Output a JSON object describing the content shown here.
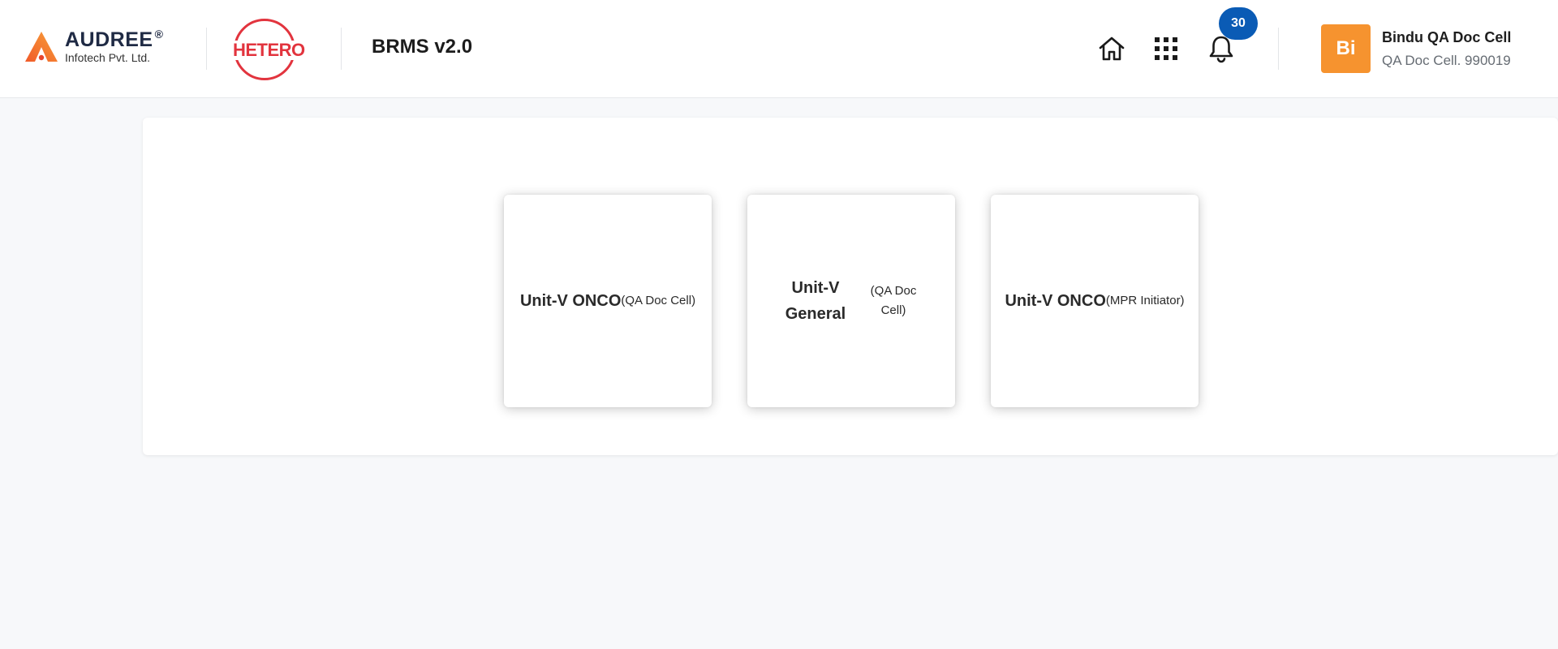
{
  "header": {
    "brand": {
      "name": "AUDREE",
      "registered": "®",
      "subtitle": "Infotech Pvt. Ltd."
    },
    "partner_logo": "HETERO",
    "app_title": "BRMS v2.0",
    "icons": {
      "home": "home-icon",
      "apps": "apps-grid-icon",
      "notifications": "bell-icon"
    },
    "notification_count": "30",
    "user": {
      "initials": "Bi",
      "name": "Bindu QA Doc Cell",
      "role": "QA Doc Cell. 990019"
    }
  },
  "cards": [
    {
      "title": "Unit-V ONCO",
      "subtitle": "(QA Doc Cell)"
    },
    {
      "title": "Unit-V General",
      "subtitle": "(QA Doc Cell)"
    },
    {
      "title": "Unit-V ONCO",
      "subtitle": "(MPR Initiator)"
    }
  ],
  "colors": {
    "brand_orange": "#f6932f",
    "hetero_red": "#e2343e",
    "badge_blue": "#0a5bb5",
    "background": "#f7f8fa"
  }
}
